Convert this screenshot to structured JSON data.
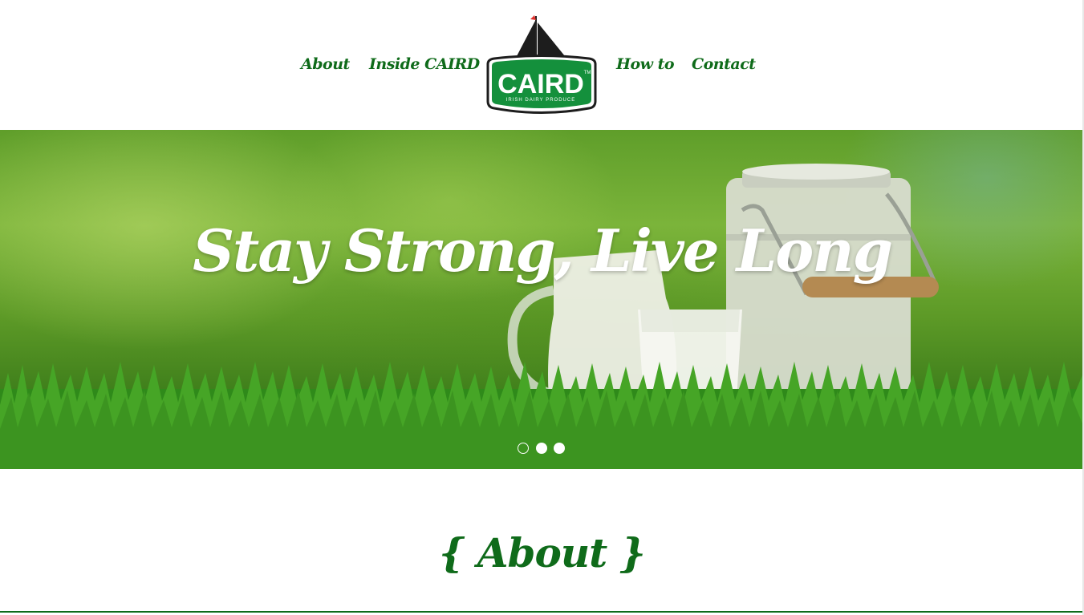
{
  "nav": {
    "about": "About",
    "inside": "Inside CAIRD",
    "howto": "How to",
    "contact": "Contact"
  },
  "logo": {
    "brand": "CAIRD",
    "tm": "TM",
    "tagline": "IRISH DAIRY PRODUCE"
  },
  "hero": {
    "title": "Stay Strong, Live Long",
    "slides": 3,
    "active_slide": 1
  },
  "about": {
    "heading": "{  About  }"
  },
  "colors": {
    "brand_green": "#0f6b1a",
    "logo_green": "#14903c",
    "sail_red": "#e2322d",
    "white": "#ffffff"
  }
}
